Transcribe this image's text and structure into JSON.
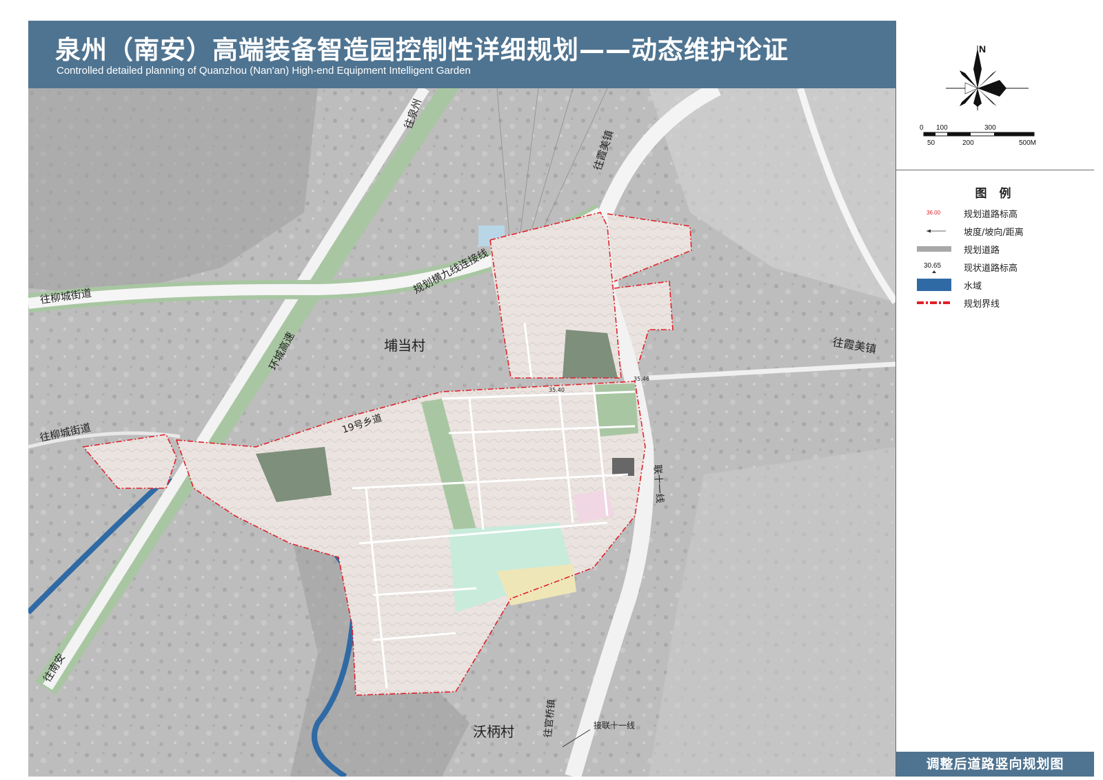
{
  "header": {
    "title_cn": "泉州（南安）高端装备智造园控制性详细规划——动态维护论证",
    "title_en": "Controlled detailed planning of Quanzhou (Nan'an) High-end Equipment Intelligent Garden"
  },
  "compass": {
    "north_label": "N"
  },
  "scale_bar": {
    "top_ticks": [
      "0",
      "100",
      "300"
    ],
    "bottom_ticks": [
      "50",
      "200",
      "500M"
    ]
  },
  "legend": {
    "title": "图 例",
    "items": [
      {
        "label": "规划道路标高",
        "symbol": "planned-elevation-icon",
        "sample_text": "36.00"
      },
      {
        "label": "坡度/坡向/距离",
        "symbol": "slope-arrow-icon",
        "sample_text": ""
      },
      {
        "label": "规划道路",
        "symbol": "planned-road-swatch",
        "sample_text": ""
      },
      {
        "label": "现状道路标高",
        "symbol": "existing-elevation-icon",
        "sample_text": "30.65"
      },
      {
        "label": "水域",
        "symbol": "water-swatch",
        "sample_text": ""
      },
      {
        "label": "规划界线",
        "symbol": "boundary-line-icon",
        "sample_text": ""
      }
    ]
  },
  "drawing_name": "调整后道路竖向规划图",
  "map_labels": {
    "to_quanzhou": "往泉州",
    "to_xiamei_top": "往霞美镇",
    "to_xiamei_right": "往霞美镇",
    "to_liucheng_upper": "往柳城街道",
    "to_liucheng_lower": "往柳城街道",
    "huancheng": "环城高速",
    "heng9": "规划横九线连接线",
    "pudang": "埔当村",
    "road_19": "19号乡道",
    "lian11": "联十一线",
    "to_nanan": "往南安",
    "to_guanqiao": "往官桥镇",
    "wobing": "沃柄村",
    "jie_lian11": "接联十一线",
    "elev_sample_1": "35.40",
    "elev_sample_2": "35.46"
  },
  "colors": {
    "header_bg": "#4f7491",
    "boundary": "#e0202a",
    "water": "#2f6aa5",
    "green_space": "#a9c6a3",
    "parcel": "#efe6e3",
    "park_cyan": "#c8ebdc",
    "parcel_yellow": "#efe6b8",
    "parcel_pink": "#f1d6e4",
    "satellite_bg": "#bdbdbd"
  }
}
